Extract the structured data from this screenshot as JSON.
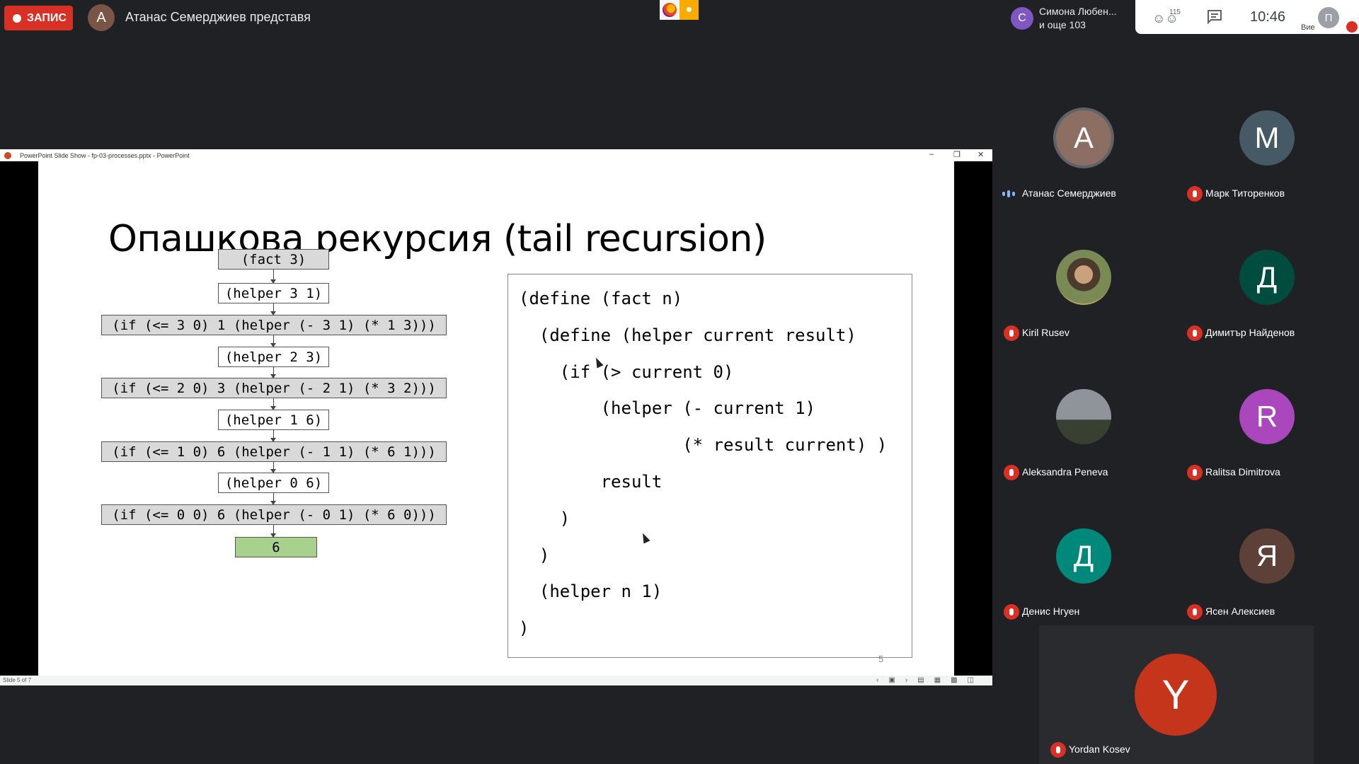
{
  "meet": {
    "recording_label": "ЗАПИС",
    "presenter_initial": "А",
    "presenter_text": "Атанас Семерджиев представя",
    "viewer_chip": {
      "initial": "С",
      "line1": "Симона Любен...",
      "line2": "и още 103"
    },
    "participant_count": "115",
    "time": "10:46",
    "self_initial": "П",
    "self_label": "Вие"
  },
  "ppt": {
    "window_title": "PowerPoint Slide Show  -  fp-03-processes.pptx  -  PowerPoint",
    "status_text": "Slide 5 of 7",
    "slide": {
      "title": "Опашкова рекурсия (tail recursion)",
      "flow": [
        {
          "text": "(fact 3)",
          "style": "gray"
        },
        {
          "text": "(helper 3 1)",
          "style": "plain"
        },
        {
          "text": "(if (<= 3 0) 1 (helper (- 3 1) (* 1 3)))",
          "style": "gray"
        },
        {
          "text": "(helper 2 3)",
          "style": "plain"
        },
        {
          "text": "(if (<= 2 0) 3 (helper (- 2 1) (* 3 2)))",
          "style": "gray"
        },
        {
          "text": "(helper 1 6)",
          "style": "plain"
        },
        {
          "text": "(if (<= 1 0) 6 (helper (- 1 1) (* 6 1)))",
          "style": "gray"
        },
        {
          "text": "(helper 0 6)",
          "style": "plain"
        },
        {
          "text": "(if (<= 0 0) 6 (helper (- 0 1) (* 6 0)))",
          "style": "gray"
        },
        {
          "text": "6",
          "style": "green"
        }
      ],
      "code": [
        "(define (fact n)",
        "  (define (helper current result)",
        "    (if (> current 0)",
        "        (helper (- current 1)",
        "                (* result current) )",
        "        result",
        "    )",
        "  )",
        "  (helper n 1)",
        ")"
      ],
      "number": "5"
    }
  },
  "participants": [
    {
      "name": "Атанас Семерджиев",
      "initial": "А",
      "color": "#8d6e63",
      "speaking": true
    },
    {
      "name": "Марк Титоренков",
      "initial": "М",
      "color": "#455a64",
      "speaking": false
    },
    {
      "name": "Kiril Rusev",
      "initial": "",
      "color": "#6d5a43",
      "speaking": false,
      "photo": "kiril"
    },
    {
      "name": "Димитър Найденов",
      "initial": "Д",
      "color": "#004d40",
      "speaking": false
    },
    {
      "name": "Aleksandra Peneva",
      "initial": "",
      "color": "#6b7073",
      "speaking": false,
      "photo": "aleks"
    },
    {
      "name": "Ralitsa Dimitrova",
      "initial": "R",
      "color": "#ab47bc",
      "speaking": false
    },
    {
      "name": "Денис Нгуен",
      "initial": "Д",
      "color": "#00897b",
      "speaking": false
    },
    {
      "name": "Ясен Алексиев",
      "initial": "Я",
      "color": "#5d4037",
      "speaking": false
    }
  ],
  "featured": {
    "name": "Yordan Kosev",
    "initial": "Y"
  }
}
